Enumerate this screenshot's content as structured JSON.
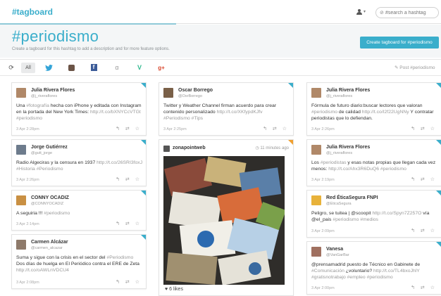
{
  "topbar": {
    "logo": "#tagboard",
    "user_caret": "▾",
    "search_placeholder": "#search a hashtag",
    "search_icon": "⊘"
  },
  "hero": {
    "title": "#periodismo",
    "subtitle": "Create a tagboard for this hashtag to add a description and for more feature options.",
    "create_button": "Create tagboard for #periodismo"
  },
  "filters": {
    "refresh_icon": "refresh-icon",
    "all": "All",
    "twitter": "twitter-icon",
    "instagram": "instagram-icon",
    "facebook": "f",
    "alpha": "α",
    "vine": "V",
    "googleplus": "g+",
    "post": "Post #periodismo"
  },
  "actions": "↰ ⇄ ☆",
  "cards": {
    "c1": {
      "name": "Julia Rivera Flores",
      "handle": "@j_riveraflores",
      "text_a": "Una ",
      "text_hl": "#fotografía",
      "text_b": " hecha con iPhone y editada con Instagram en la portada del New York Times: ",
      "text_link": "http://t.co/bXNYCcVTGt #periodismo",
      "time": "3 Apr 2:28pm"
    },
    "c2": {
      "name": "Jorge Gutiérrez",
      "handle": "@gutt_jorge",
      "text_a": "Radio Algeciras y la censura en 1937 ",
      "text_link": "http://t.co/26SRI3foxJ #Historia #Periodismo",
      "time": "3 Apr 2:26pm"
    },
    "c3": {
      "name": "CONNY OCADIZ",
      "handle": "@CONNYOCADIZ",
      "text_a": "A seguiria !!! ",
      "text_link": "#periodismo",
      "time": "3 Apr 2:14pm"
    },
    "c4": {
      "name": "Carmen Alcázar",
      "handle": "@carmen_alcazar",
      "text_a": "Suma y sigue con la crisis en el sector del ",
      "text_hl": "#Periodismo",
      "text_b": " Dos días de huelga en El Periódico contra el ERE de Zeta ",
      "text_link": "http://t.co/oAWLnVDCU4",
      "time": "3 Apr 2:08pm"
    },
    "c5": {
      "name": "Oscar Borrego",
      "handle": "@OsrBorrego",
      "text_a": "Twitter y Weather Channel firman acuerdo para crear contenido personalizado ",
      "text_link": "http://t.co/XKfypdKJfv #Periodismo #Tips",
      "time": "3 Apr 2:25pm"
    },
    "c6": {
      "name": "zonapointweb",
      "ago": "11 minutes ago",
      "likes": "6 likes"
    },
    "c7": {
      "name": "Julia Rivera Flores",
      "handle": "@j_riveraflores",
      "text_a": "Fórmula de futuro diario:buscar lectores que valoran ",
      "text_hl": "#periodismo",
      "text_b": " de calidad ",
      "text_link": "http://t.co/I2f22UgNNy",
      "text_c": " Y contratar periodistas que lo defiendan.",
      "time": "3 Apr 2:26pm"
    },
    "c8": {
      "name": "Julia Rivera Flores",
      "handle": "@j_riveraflores",
      "text_a": "Los ",
      "text_hl": "#periodistas",
      "text_b": " y esas notas propias que llegan cada vez menos: ",
      "text_link": "http://t.co/Ahx3R6DuQ6 #periodismo",
      "time": "3 Apr 2:19pm"
    },
    "c9": {
      "name": "Red ÉticaSegura FNPI",
      "handle": "@EticaSegura",
      "text_a": "Peligro, se tuitea | @scoopit ",
      "text_link": "http://t.co/Spyn7Z257O",
      "text_b": " vía @el_pais ",
      "text_hl": "#periodismo #medios",
      "time": "3 Apr 2:09pm"
    },
    "c10": {
      "name": "Vanesa",
      "handle": "@VanGarBar",
      "text_a": "@prensamadrid puesto de Técnico en Gabinete de ",
      "text_hl": "#Comunicación",
      "text_b": " ¿voluntario? ",
      "text_link": "http://t.co/TL4bxoJhlY #gratisnotrabajo #empleo #periodismo",
      "time": "3 Apr 2:00pm"
    }
  },
  "colors": {
    "accent": "#3aaecb",
    "twitter": "#33a4d8",
    "facebook": "#3b5b98",
    "googleplus": "#d9482e",
    "vine": "#31b98f"
  }
}
